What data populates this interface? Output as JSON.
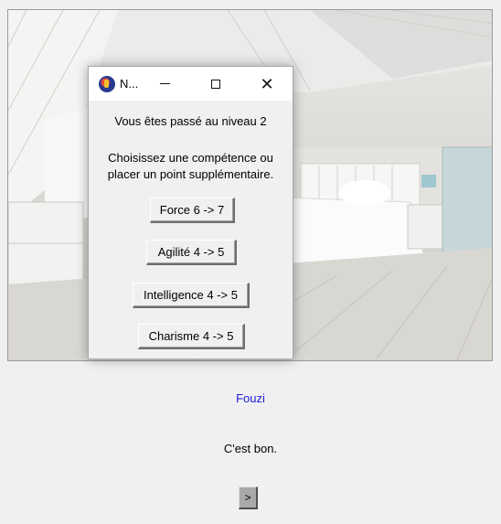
{
  "dialog": {
    "title": "N...",
    "message_level": "Vous êtes passé au niveau 2",
    "message_choose_line1": "Choisissez une compétence ou",
    "message_choose_line2": "placer un point supplémentaire.",
    "buttons": [
      "Force 6 -> 7",
      "Agilité 4 -> 5",
      "Intelligence 4 -> 5",
      "Charisme 4 -> 5"
    ]
  },
  "speaker": {
    "name": "Fouzi",
    "color": "#1a1adb"
  },
  "dialogue_line": "C'est bon.",
  "next_button_label": ">",
  "scene": {
    "icon": "bedroom-background-image"
  }
}
